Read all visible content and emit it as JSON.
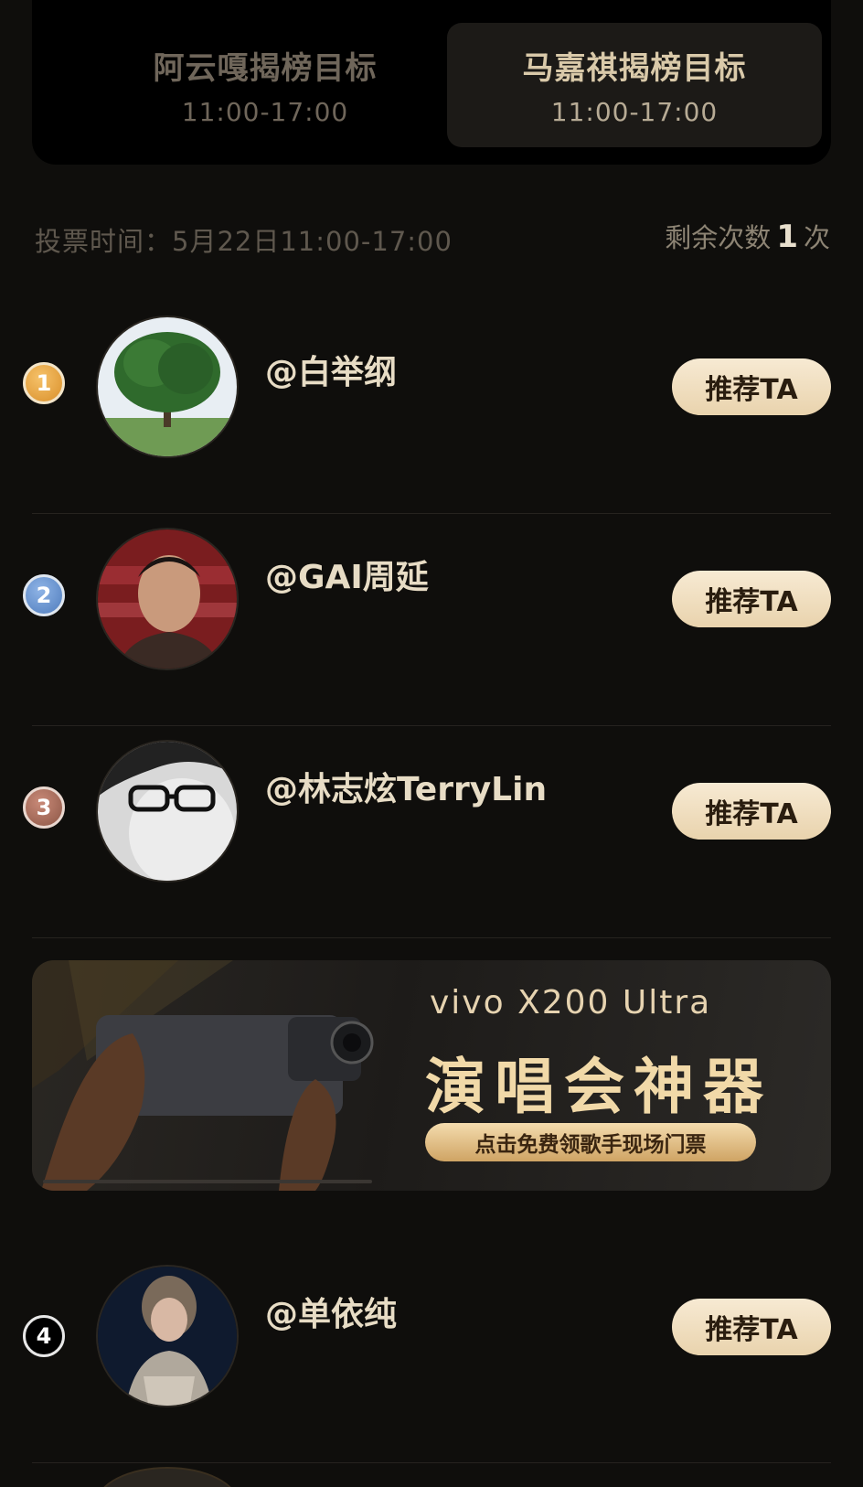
{
  "tabs": [
    {
      "title": "阿云嘎揭榜目标",
      "time": "11:00-17:00"
    },
    {
      "title": "马嘉祺揭榜目标",
      "time": "11:00-17:00"
    }
  ],
  "vote": {
    "time_label": "投票时间：5月22日11:00-17:00",
    "remaining_prefix": "剩余次数",
    "remaining_count": "1",
    "remaining_suffix": "次"
  },
  "list": [
    {
      "rank": "1",
      "name": "@白举纲",
      "button": "推荐TA",
      "avatar_icon": "tree-avatar"
    },
    {
      "rank": "2",
      "name": "@GAI周延",
      "button": "推荐TA",
      "avatar_icon": "portrait-avatar"
    },
    {
      "rank": "3",
      "name": "@林志炫TerryLin",
      "button": "推荐TA",
      "avatar_icon": "glasses-portrait-avatar"
    },
    {
      "rank": "4",
      "name": "@单依纯",
      "button": "推荐TA",
      "avatar_icon": "singer-portrait-avatar"
    }
  ],
  "banner": {
    "title": "vivo X200 Ultra",
    "subtitle": "演唱会神器",
    "cta": "点击免费领歌手现场门票"
  },
  "colors": {
    "background": "#0f0e0c",
    "button_gold": "#f0dfc0",
    "rank1": "#e29a35",
    "rank2": "#5f8fd0",
    "rank3": "#9b6555"
  }
}
